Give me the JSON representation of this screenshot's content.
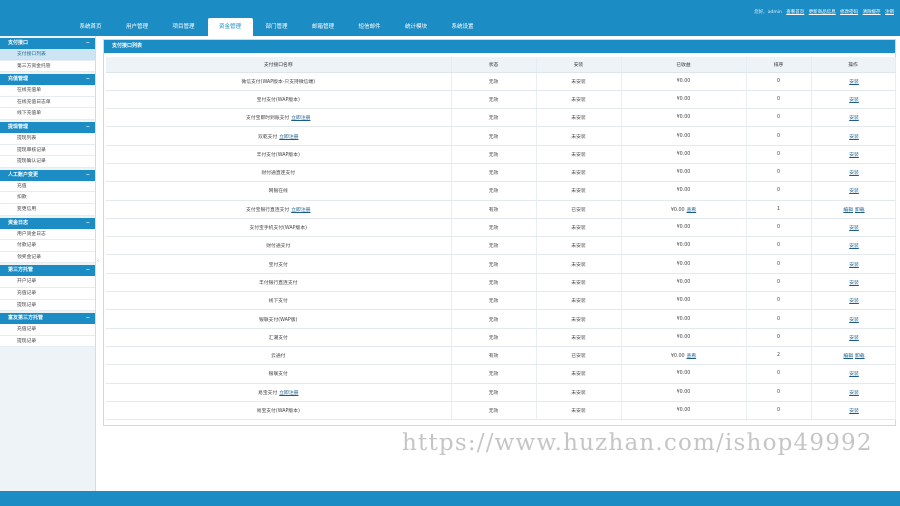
{
  "header": {
    "user_prefix": "您好,",
    "user_name": "admin",
    "links": [
      "查看首页",
      "更新商品信息",
      "修改密码",
      "清除缓存",
      "注销"
    ]
  },
  "nav": [
    "系统首页",
    "用户管理",
    "项目管理",
    "资金管理",
    "部门管理",
    "邮箱管理",
    "短信邮件",
    "统计模块",
    "系统设置"
  ],
  "nav_active_index": 3,
  "sidebar": [
    {
      "title": "支付接口",
      "items": [
        "支付接口列表",
        "第三方资金托管"
      ]
    },
    {
      "title": "充值管理",
      "items": [
        "在线充值单",
        "在线充值日志单",
        "线下充值单"
      ]
    },
    {
      "title": "提现管理",
      "items": [
        "提现列表",
        "提现审核记录",
        "提现确认记录"
      ]
    },
    {
      "title": "人工账户变更",
      "items": [
        "充值",
        "扣款",
        "变更信用"
      ]
    },
    {
      "title": "资金日志",
      "items": [
        "用户资金日志",
        "付款记录",
        "领奖金记录"
      ]
    },
    {
      "title": "第三方托管",
      "items": [
        "开户记录",
        "充值记录",
        "提现记录"
      ]
    },
    {
      "title": "富友第三方托管",
      "items": [
        "充值记录",
        "提现记录"
      ]
    }
  ],
  "sidebar_collapse": "‹",
  "panel_title": "支付接口列表",
  "table": {
    "columns": [
      "支付接口名称",
      "状态",
      "安装",
      "已收益",
      "排序",
      "操作"
    ],
    "rows": [
      {
        "name": "微信支付(WAP版本-只支持微信端)",
        "link": "",
        "status": "无效",
        "install": "未安装",
        "earn": "¥0.00",
        "detail": "",
        "sort": "0",
        "ops": [
          "安装"
        ]
      },
      {
        "name": "宝付支付(WAP版本)",
        "link": "",
        "status": "无效",
        "install": "未安装",
        "earn": "¥0.00",
        "detail": "",
        "sort": "0",
        "ops": [
          "安装"
        ]
      },
      {
        "name": "支付宝即时到账支付",
        "link": "立即注册",
        "status": "无效",
        "install": "未安装",
        "earn": "¥0.00",
        "detail": "",
        "sort": "0",
        "ops": [
          "安装"
        ]
      },
      {
        "name": "双乾支付",
        "link": "立即注册",
        "status": "无效",
        "install": "未安装",
        "earn": "¥0.00",
        "detail": "",
        "sort": "0",
        "ops": [
          "安装"
        ]
      },
      {
        "name": "丰付支付(WAP版本)",
        "link": "",
        "status": "无效",
        "install": "未安装",
        "earn": "¥0.00",
        "detail": "",
        "sort": "0",
        "ops": [
          "安装"
        ]
      },
      {
        "name": "财付通直连支付",
        "link": "",
        "status": "无效",
        "install": "未安装",
        "earn": "¥0.00",
        "detail": "",
        "sort": "0",
        "ops": [
          "安装"
        ]
      },
      {
        "name": "网银在线",
        "link": "",
        "status": "无效",
        "install": "未安装",
        "earn": "¥0.00",
        "detail": "",
        "sort": "0",
        "ops": [
          "安装"
        ]
      },
      {
        "name": "支付宝银行直连支付",
        "link": "立即注册",
        "status": "有效",
        "install": "已安装",
        "earn": "¥0.00",
        "detail": "查看",
        "sort": "1",
        "ops": [
          "编辑",
          "卸载"
        ]
      },
      {
        "name": "支付宝手机支付(WAP版本)",
        "link": "",
        "status": "无效",
        "install": "未安装",
        "earn": "¥0.00",
        "detail": "",
        "sort": "0",
        "ops": [
          "安装"
        ]
      },
      {
        "name": "财付通支付",
        "link": "",
        "status": "无效",
        "install": "未安装",
        "earn": "¥0.00",
        "detail": "",
        "sort": "0",
        "ops": [
          "安装"
        ]
      },
      {
        "name": "宝付支付",
        "link": "",
        "status": "无效",
        "install": "未安装",
        "earn": "¥0.00",
        "detail": "",
        "sort": "0",
        "ops": [
          "安装"
        ]
      },
      {
        "name": "丰付银行直连支付",
        "link": "",
        "status": "无效",
        "install": "未安装",
        "earn": "¥0.00",
        "detail": "",
        "sort": "0",
        "ops": [
          "安装"
        ]
      },
      {
        "name": "线下支付",
        "link": "",
        "status": "无效",
        "install": "未安装",
        "earn": "¥0.00",
        "detail": "",
        "sort": "0",
        "ops": [
          "安装"
        ]
      },
      {
        "name": "银联支付(WAP版)",
        "link": "",
        "status": "无效",
        "install": "未安装",
        "earn": "¥0.00",
        "detail": "",
        "sort": "0",
        "ops": [
          "安装"
        ]
      },
      {
        "name": "汇潮支付",
        "link": "",
        "status": "无效",
        "install": "未安装",
        "earn": "¥0.00",
        "detail": "",
        "sort": "0",
        "ops": [
          "安装"
        ]
      },
      {
        "name": "云通付",
        "link": "",
        "status": "有效",
        "install": "已安装",
        "earn": "¥0.00",
        "detail": "查看",
        "sort": "2",
        "ops": [
          "编辑",
          "卸载"
        ]
      },
      {
        "name": "银联支付",
        "link": "",
        "status": "无效",
        "install": "未安装",
        "earn": "¥0.00",
        "detail": "",
        "sort": "0",
        "ops": [
          "安装"
        ]
      },
      {
        "name": "易宝支付",
        "link": "立即注册",
        "status": "无效",
        "install": "未安装",
        "earn": "¥0.00",
        "detail": "",
        "sort": "0",
        "ops": [
          "安装"
        ]
      },
      {
        "name": "易宝支付(WAP版本)",
        "link": "",
        "status": "无效",
        "install": "未安装",
        "earn": "¥0.00",
        "detail": "",
        "sort": "0",
        "ops": [
          "安装"
        ]
      }
    ]
  },
  "watermark": "https://www.huzhan.com/ishop49992",
  "colors": {
    "brand": "#1c8cc4",
    "sidebar_bg": "#eef3f7",
    "link": "#1a5c8a"
  }
}
